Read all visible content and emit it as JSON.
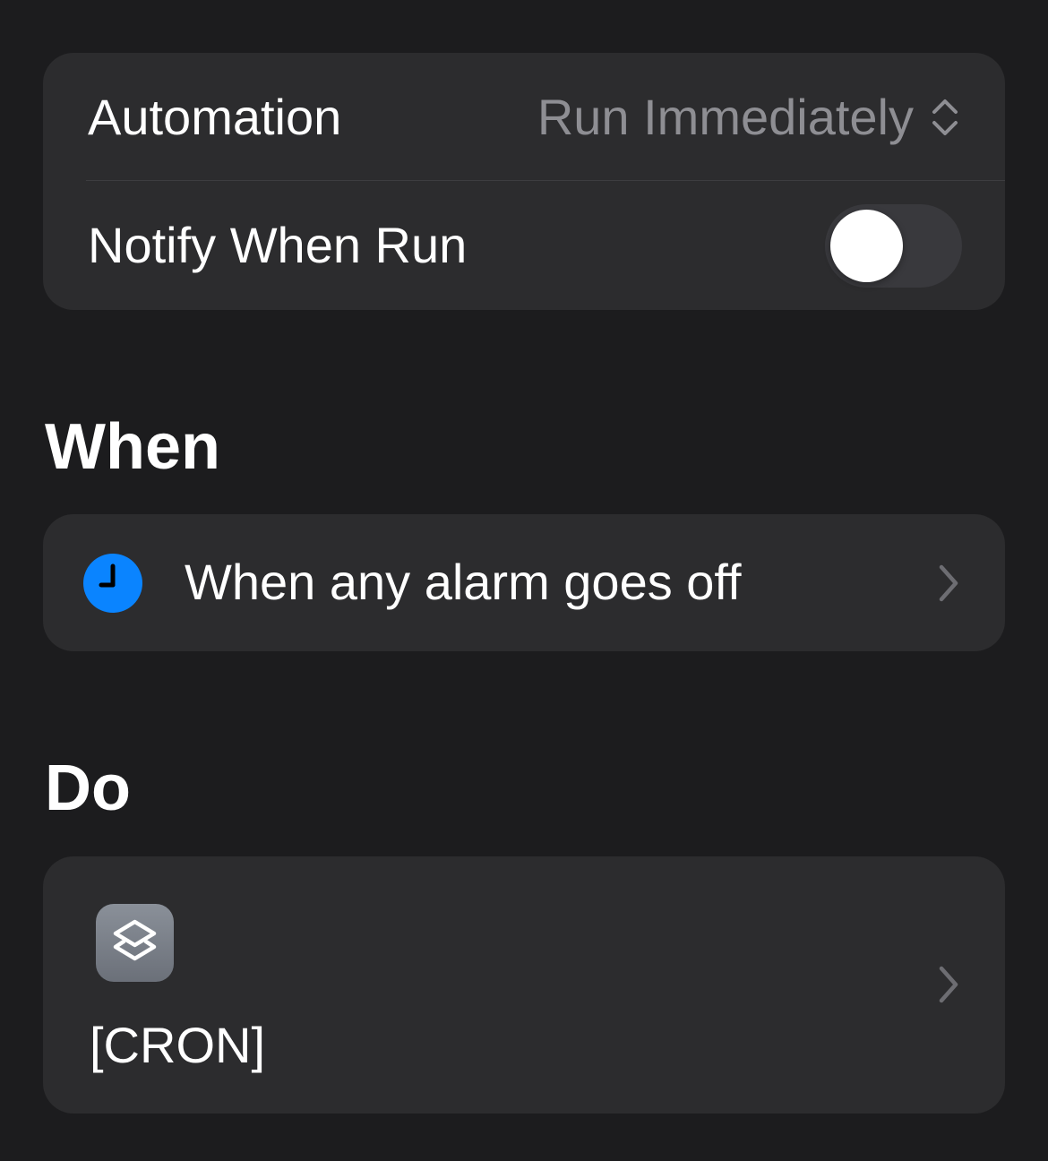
{
  "settings": {
    "automation_label": "Automation",
    "automation_value": "Run Immediately",
    "automation_icon": "chevron-up-down-icon",
    "notify_label": "Notify When Run",
    "notify_enabled": false
  },
  "when_section": {
    "title": "When",
    "trigger_text": "When any alarm goes off",
    "trigger_icon": "clock-icon",
    "trigger_icon_color": "#0a84ff"
  },
  "do_section": {
    "title": "Do",
    "shortcut_name": "[CRON]",
    "shortcut_icon": "shortcuts-icon"
  },
  "colors": {
    "background": "#1c1c1e",
    "card": "#2c2c2e",
    "secondary_text": "#8e8e93",
    "toggle_off_track": "#39393d"
  }
}
